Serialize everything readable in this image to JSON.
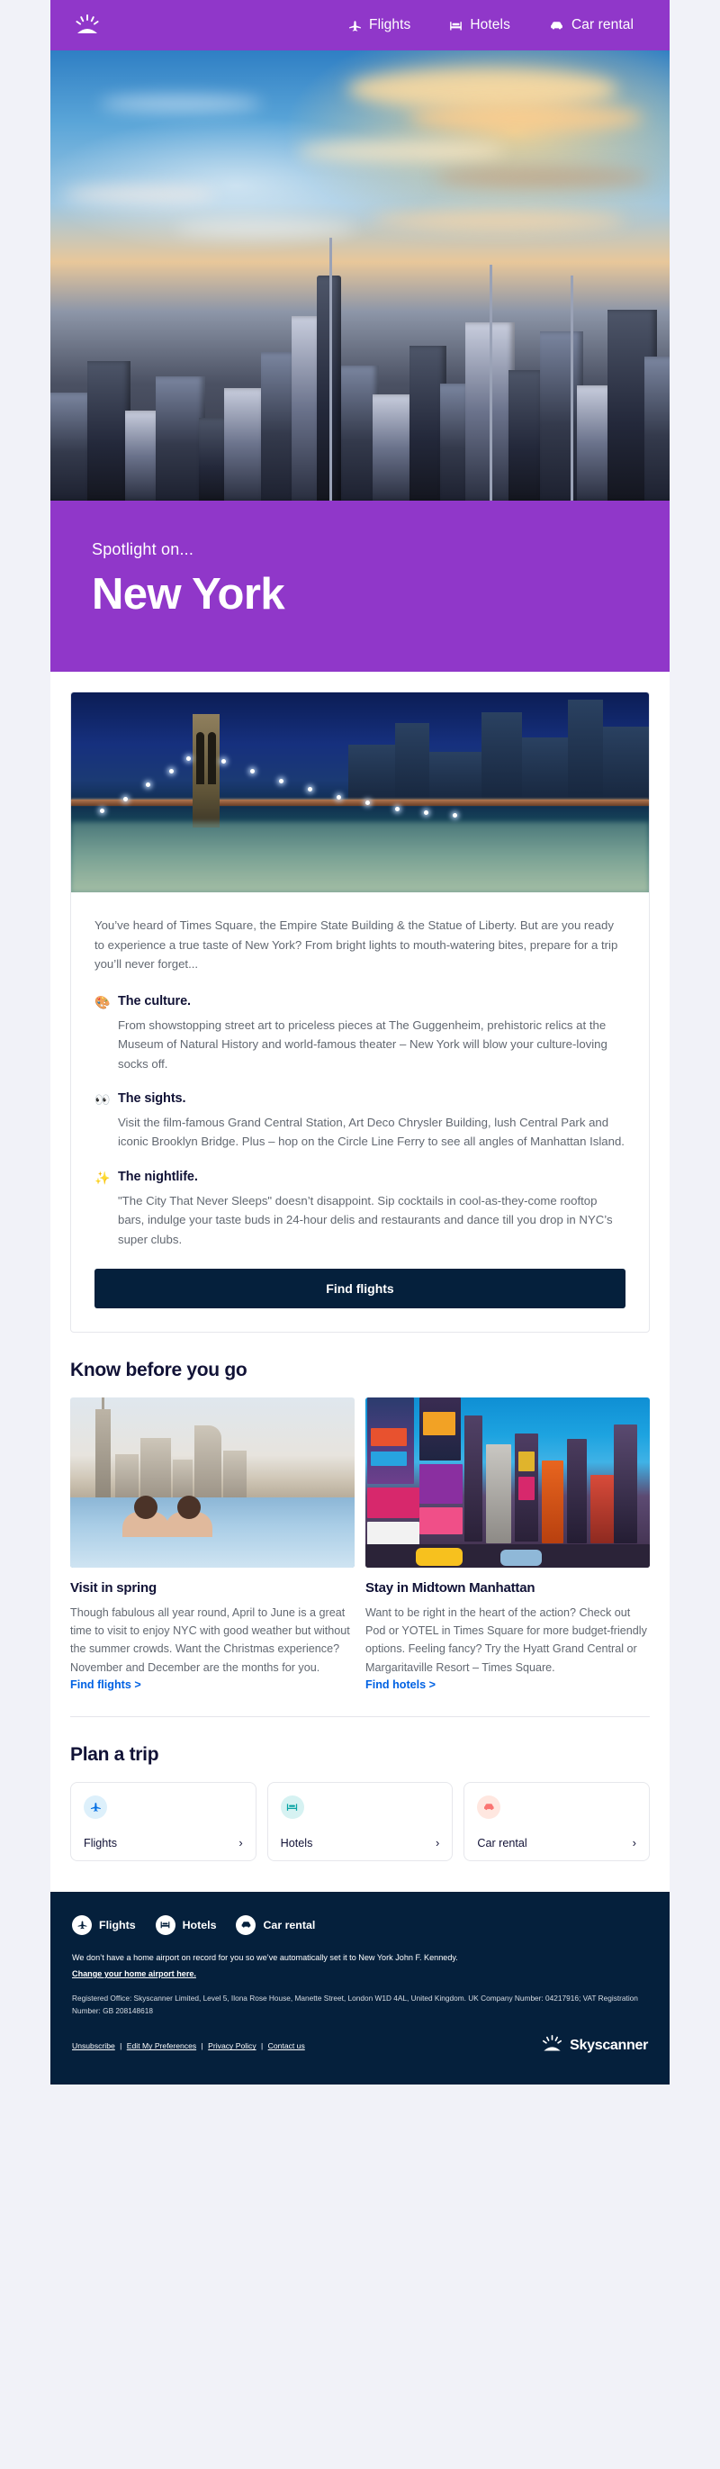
{
  "brand": {
    "name": "Skyscanner",
    "logo_icon": "sunrise-icon",
    "purple": "#9037c9",
    "navy": "#05203c",
    "link_blue": "#0062e3"
  },
  "header": {
    "nav": [
      {
        "label": "Flights",
        "icon": "plane-icon"
      },
      {
        "label": "Hotels",
        "icon": "bed-icon"
      },
      {
        "label": "Car rental",
        "icon": "car-icon"
      }
    ]
  },
  "spotlight": {
    "kicker": "Spotlight on...",
    "city": "New York"
  },
  "article": {
    "lead": "You’ve heard of Times Square, the Empire State Building & the Statue of Liberty. But are you ready to experience a true taste of New York? From bright lights to mouth-watering bites, prepare for a trip you’ll never forget...",
    "facts": [
      {
        "emoji": "🎨",
        "icon": "palette-emoji",
        "title": "The culture.",
        "body": "From showstopping street art to priceless pieces at The Guggenheim, prehistoric relics at the Museum of Natural History and world-famous theater – New York will blow your culture-loving socks off."
      },
      {
        "emoji": "👀",
        "icon": "eyes-emoji",
        "title": "The sights.",
        "body": "Visit the film-famous Grand Central Station, Art Deco Chrysler Building, lush Central Park and iconic Brooklyn Bridge. Plus – hop on the Circle Line Ferry to see all angles of Manhattan Island."
      },
      {
        "emoji": "✨",
        "icon": "sparkles-emoji",
        "title": "The nightlife.",
        "body": "\"The City That Never Sleeps\" doesn’t disappoint. Sip cocktails in cool-as-they-come rooftop bars, indulge your taste buds in 24-hour delis and restaurants and dance till you drop in NYC’s super clubs."
      }
    ],
    "cta_label": "Find flights"
  },
  "know_section": {
    "heading": "Know before you go",
    "cards": [
      {
        "title": "Visit in spring",
        "body": "Though fabulous all year round, April to June is a great time to visit to enjoy NYC with good weather but without the summer crowds. Want the Christmas experience? November and December are the months for you.",
        "link_label": "Find flights >"
      },
      {
        "title": "Stay in Midtown Manhattan",
        "body": "Want to be right in the heart of the action? Check out Pod or YOTEL in Times Square for more budget-friendly options. Feeling fancy? Try the Hyatt Grand Central or Margaritaville Resort – Times Square.",
        "link_label": "Find hotels >"
      }
    ]
  },
  "plan_section": {
    "heading": "Plan a trip",
    "tiles": [
      {
        "label": "Flights",
        "icon": "plane-icon",
        "chevron": "›"
      },
      {
        "label": "Hotels",
        "icon": "bed-icon",
        "chevron": "›"
      },
      {
        "label": "Car rental",
        "icon": "car-icon",
        "chevron": "›"
      }
    ]
  },
  "footer": {
    "nav": [
      {
        "label": "Flights",
        "icon": "plane-icon"
      },
      {
        "label": "Hotels",
        "icon": "bed-icon"
      },
      {
        "label": "Car rental",
        "icon": "car-icon"
      }
    ],
    "airport_note": "We don’t have a home airport on record for you so we’ve automatically set it to New York John F. Kennedy.",
    "airport_link": "Change your home airport here.",
    "registered": "Registered Office: Skyscanner Limited, Level 5, Ilona Rose House, Manette Street, London W1D 4AL, United Kingdom. UK Company Number: 04217916; VAT Registration Number: GB 208148618",
    "links": [
      "Unsubscribe",
      "Edit My Preferences",
      "Privacy Policy",
      "Contact us"
    ],
    "separator": "|",
    "brand_name": "Skyscanner"
  }
}
